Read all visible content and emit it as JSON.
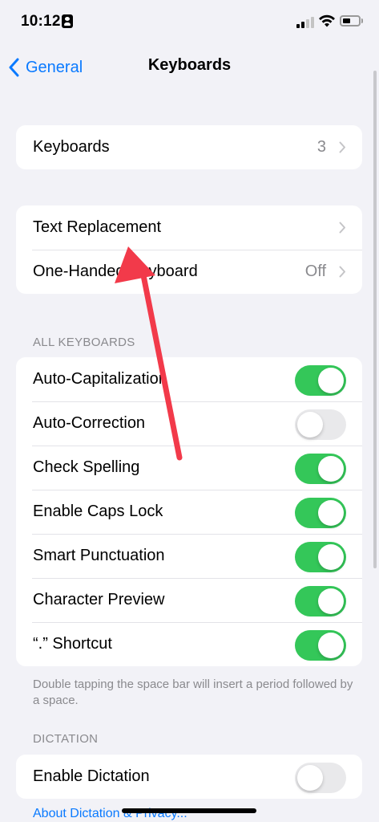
{
  "status_bar": {
    "time": "10:12"
  },
  "nav": {
    "back_label": "General",
    "title": "Keyboards"
  },
  "group1": {
    "keyboards_label": "Keyboards",
    "keyboards_value": "3"
  },
  "group2": {
    "text_replacement_label": "Text Replacement",
    "one_handed_label": "One-Handed Keyboard",
    "one_handed_value": "Off"
  },
  "all_keyboards": {
    "header": "ALL KEYBOARDS",
    "items": [
      {
        "label": "Auto-Capitalization",
        "on": true
      },
      {
        "label": "Auto-Correction",
        "on": false
      },
      {
        "label": "Check Spelling",
        "on": true
      },
      {
        "label": "Enable Caps Lock",
        "on": true
      },
      {
        "label": "Smart Punctuation",
        "on": true
      },
      {
        "label": "Character Preview",
        "on": true
      },
      {
        "label": "“.” Shortcut",
        "on": true
      }
    ],
    "footer": "Double tapping the space bar will insert a period followed by a space."
  },
  "dictation": {
    "header": "DICTATION",
    "enable_label": "Enable Dictation",
    "enable_on": false,
    "about_link": "About Dictation & Privacy..."
  },
  "colors": {
    "accent": "#0a7aff",
    "toggle_on": "#34c759",
    "arrow": "#f23a4a"
  },
  "icons": [
    "person-id-icon",
    "cellular-signal-icon",
    "wifi-icon",
    "battery-icon",
    "chevron-left-icon",
    "chevron-right-icon",
    "annotation-arrow"
  ]
}
